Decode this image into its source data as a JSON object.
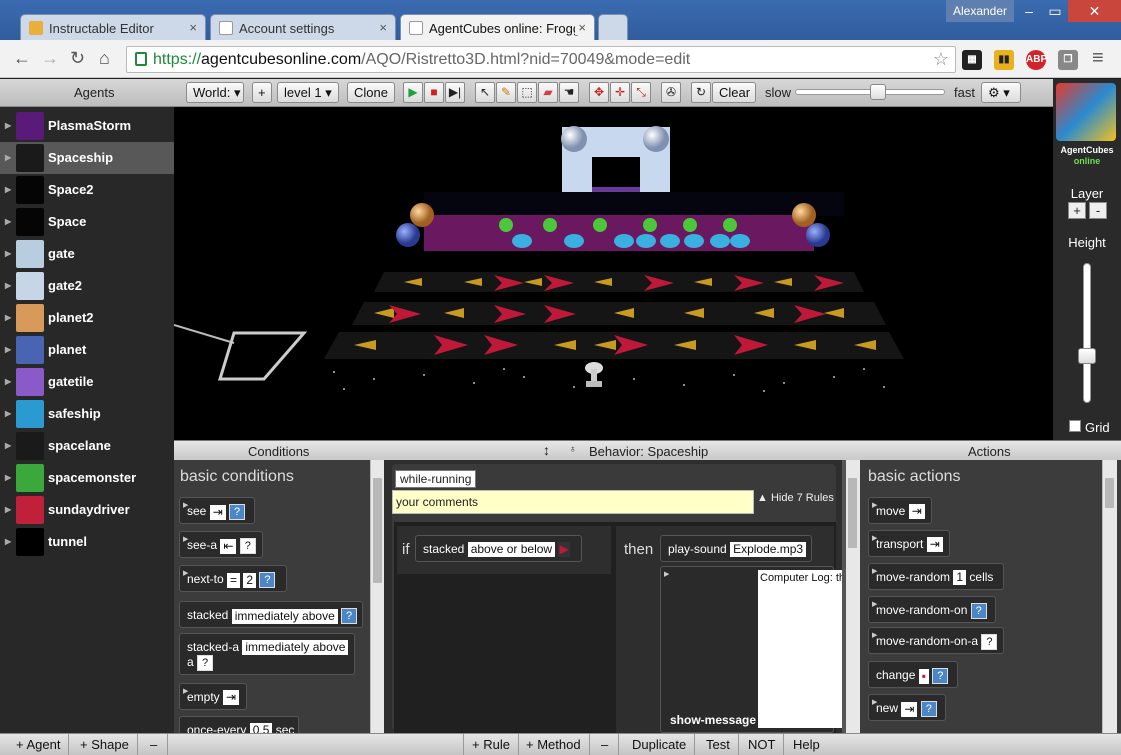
{
  "browser": {
    "tabs": [
      {
        "title": "Instructable Editor",
        "active": false
      },
      {
        "title": "Account settings",
        "active": false
      },
      {
        "title": "AgentCubes online: Frogg",
        "active": true
      }
    ],
    "user": "Alexander",
    "url_https": "https://",
    "url_domain": "agentcubesonline.com",
    "url_path": "/AQO/Ristretto3D.html?nid=70049&mode=edit",
    "ext_abp": "ABP"
  },
  "toolbar": {
    "agents_label": "Agents",
    "world_label": "World:",
    "plus": "+",
    "level": "level 1",
    "clone": "Clone",
    "clear": "Clear",
    "slow": "slow",
    "fast": "fast",
    "speed": 0.55
  },
  "agents": [
    {
      "name": "PlasmaStorm",
      "color": "#5a1a7a",
      "selected": false
    },
    {
      "name": "Spaceship",
      "color": "#1a1a1a",
      "selected": true
    },
    {
      "name": "Space2",
      "color": "#050505",
      "selected": false
    },
    {
      "name": "Space",
      "color": "#050505",
      "selected": false
    },
    {
      "name": "gate",
      "color": "#b9cde0",
      "selected": false
    },
    {
      "name": "gate2",
      "color": "#c7d6e6",
      "selected": false
    },
    {
      "name": "planet2",
      "color": "#d79a5a",
      "selected": false
    },
    {
      "name": "planet",
      "color": "#4a64b4",
      "selected": false
    },
    {
      "name": "gatetile",
      "color": "#8a5ac8",
      "selected": false
    },
    {
      "name": "safeship",
      "color": "#2a9ad0",
      "selected": false
    },
    {
      "name": "spacelane",
      "color": "#1a1a1a",
      "selected": false
    },
    {
      "name": "spacemonster",
      "color": "#3aa83a",
      "selected": false
    },
    {
      "name": "sundaydriver",
      "color": "#c0203a",
      "selected": false
    },
    {
      "name": "tunnel",
      "color": "#000000",
      "selected": false
    }
  ],
  "sidepanel": {
    "logo_title": "AgentCubes",
    "logo_sub": "online",
    "layer": "Layer",
    "plus": "+",
    "minus": "-",
    "height": "Height",
    "height_value": 0.32,
    "grid": "Grid"
  },
  "headers": {
    "conditions": "Conditions",
    "behavior": "Behavior: Spaceship",
    "actions": "Actions"
  },
  "conditions": {
    "section": "basic conditions",
    "items": [
      {
        "label": "see"
      },
      {
        "label": "see-a"
      },
      {
        "label": "next-to",
        "op": "=",
        "value": "2"
      },
      {
        "label": "stacked",
        "option": "immediately above"
      },
      {
        "label": "stacked-a",
        "option": "immediately above",
        "suffix": "a"
      },
      {
        "label": "empty"
      },
      {
        "label": "once-every",
        "value": "0.5",
        "unit": "sec"
      }
    ]
  },
  "behavior": {
    "method": "while-running",
    "comment": "your comments",
    "hide_rules": "Hide 7 Rules",
    "if": "if",
    "then": "then",
    "cond_label": "stacked",
    "cond_option": "above or below",
    "action_label": "play-sound",
    "sound": "Explode.mp3",
    "show_message": "show-message",
    "message": "Computer Log: the starboard b failure. Attempt auxiliary power compensate. A failure. WARNI impact has disa antimatter conta Warp core brea imminent! KABO over."
  },
  "actions": {
    "section": "basic actions",
    "items": [
      {
        "label": "move"
      },
      {
        "label": "transport"
      },
      {
        "label": "move-random",
        "value": "1",
        "unit": "cells"
      },
      {
        "label": "move-random-on"
      },
      {
        "label": "move-random-on-a"
      },
      {
        "label": "change"
      },
      {
        "label": "new"
      }
    ]
  },
  "bottom": {
    "add_agent": "+ Agent",
    "add_shape": "+ Shape",
    "minus1": "–",
    "add_rule": "+ Rule",
    "add_method": "+ Method",
    "minus2": "–",
    "duplicate": "Duplicate",
    "test": "Test",
    "not": "NOT",
    "help": "Help"
  }
}
